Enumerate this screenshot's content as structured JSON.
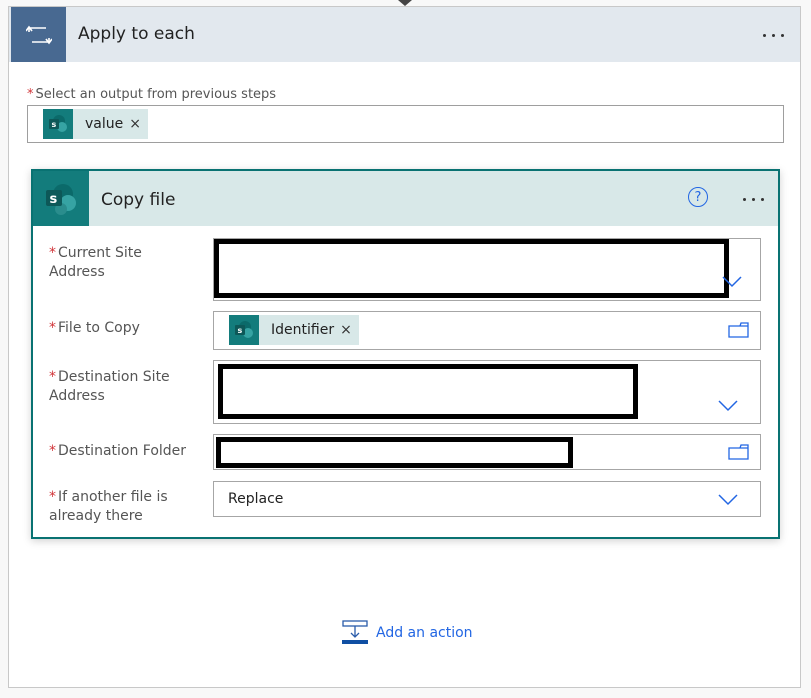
{
  "apply_to_each": {
    "title": "Apply to each",
    "icon": "loop-icon",
    "more_icon": "more-options-icon",
    "select_label": "Select an output from previous steps",
    "select_required": "*",
    "select_token": {
      "label": "value",
      "icon": "sharepoint-icon",
      "remove": "×"
    }
  },
  "copy_file": {
    "title": "Copy file",
    "icon": "sharepoint-icon",
    "help": "?",
    "more_icon": "more-options-icon",
    "fields": [
      {
        "label": "Current Site Address",
        "required": "*",
        "value": "[redacted]",
        "control": "dropdown"
      },
      {
        "label": "File to Copy",
        "required": "*",
        "token": {
          "label": "Identifier",
          "icon": "sharepoint-icon",
          "remove": "×"
        },
        "control": "folder-picker"
      },
      {
        "label": "Destination Site Address",
        "required": "*",
        "value": "[redacted]",
        "control": "dropdown"
      },
      {
        "label": "Destination Folder",
        "required": "*",
        "value": "[redacted]",
        "control": "folder-picker"
      },
      {
        "label": "If another file is already there",
        "required": "*",
        "value": "Replace",
        "control": "dropdown"
      }
    ]
  },
  "add_action": {
    "label": "Add an action",
    "icon": "add-action-icon"
  },
  "colors": {
    "apply_header_bg": "#e2e8ee",
    "apply_icon_bg": "#486991",
    "sharepoint_teal": "#137c7c",
    "copy_card_border": "#097272",
    "copy_header_bg": "#d8e8e8",
    "accent_blue": "#2266e3",
    "required_red": "#d13438"
  }
}
